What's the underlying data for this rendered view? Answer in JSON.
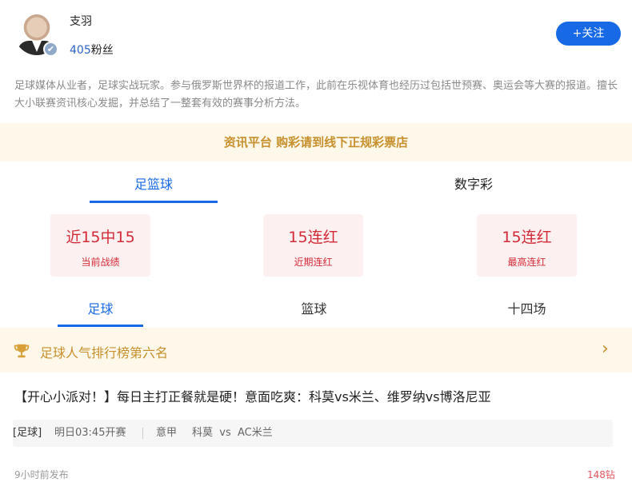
{
  "author": {
    "name": "支羽",
    "fans_count": "405",
    "fans_suffix": "粉丝",
    "follow_label": "+关注",
    "bio": "足球媒体从业者，足球实战玩家。参与俄罗斯世界杯的报道工作，此前在乐视体育也经历过包括世预赛、奥运会等大赛的报道。擅长大小联赛资讯核心发掘，并总结了一整套有效的赛事分析方法。"
  },
  "notice": "资讯平台 购彩请到线下正规彩票店",
  "category_tabs": [
    {
      "label": "足篮球",
      "active": true
    },
    {
      "label": "数字彩",
      "active": false
    }
  ],
  "stats": [
    {
      "value": "近15中15",
      "label": "当前战绩"
    },
    {
      "value": "15连红",
      "label": "近期连红"
    },
    {
      "value": "15连红",
      "label": "最高连红"
    }
  ],
  "sub_tabs": [
    {
      "label": "足球",
      "active": true
    },
    {
      "label": "篮球",
      "active": false
    },
    {
      "label": "十四场",
      "active": false
    }
  ],
  "rank": {
    "icon": "trophy-icon",
    "text": "足球人气排行榜第六名",
    "arrow_icon": "chevron-right-icon"
  },
  "article": {
    "title": "【开心小派对！】每日主打正餐就是硬！意面吃爽：科莫vs米兰、维罗纳vs博洛尼亚",
    "match": {
      "tag": "[足球]",
      "time": "明日03:45开赛",
      "league": "意甲",
      "teams": "科莫  vs  AC米兰"
    },
    "published": "9小时前发布",
    "price": "148钻"
  },
  "colors": {
    "accent": "#1769e6",
    "gold": "#c8902c",
    "red": "#d32a36"
  }
}
